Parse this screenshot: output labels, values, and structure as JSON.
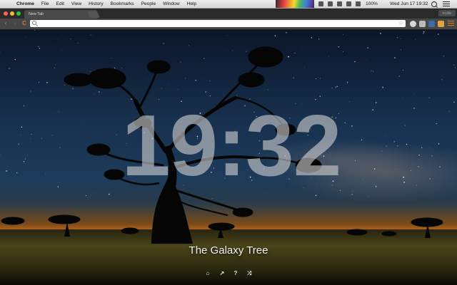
{
  "menubar": {
    "apple": "",
    "items": [
      "Chrome",
      "File",
      "Edit",
      "View",
      "History",
      "Bookmarks",
      "People",
      "Window",
      "Help"
    ],
    "battery": "100%",
    "clock": "Wed Jun 17  19:32"
  },
  "tabs": {
    "active_label": "New Tab",
    "close": "×",
    "profile": "Profile"
  },
  "toolbar": {
    "back": "‹",
    "forward": "›",
    "reload": "C",
    "url_value": "",
    "url_placeholder": "",
    "star": "☆"
  },
  "newtab": {
    "time": "19:32",
    "title": "The Galaxy Tree",
    "icons": [
      "home-icon",
      "open-external-icon",
      "help-icon",
      "shuffle-icon"
    ],
    "icon_glyphs": [
      "⌂",
      "↗",
      "?",
      "⤨"
    ]
  },
  "colors": {
    "menubar": "#e2e2e2",
    "tabstrip": "#2a2a2a",
    "toolbar": "#464646",
    "reload_accent": "#e0722a",
    "clock_text": "#cdcdcd"
  }
}
